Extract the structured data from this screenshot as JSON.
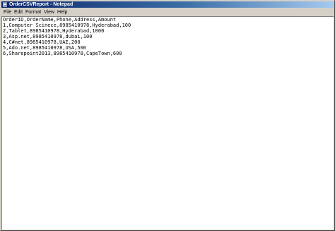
{
  "window": {
    "title": "OrderCSVReport - Notepad",
    "icon": "notepad-icon"
  },
  "menu": {
    "items": [
      {
        "label": "File"
      },
      {
        "label": "Edit"
      },
      {
        "label": "Format"
      },
      {
        "label": "View"
      },
      {
        "label": "Help"
      }
    ]
  },
  "editor": {
    "lines": [
      "OrderID,OrderName,Phone,Address,Amount",
      "1,Computer Scinece,8985410978,Hyderabad,100",
      "2,Tablet,8985410978,Hyderabad,1000",
      "3,Asp.net,8985410978,dubai,100",
      "4,C#net,8985410978,UAE,200",
      "5,Ado.net,8985410978,USA,500",
      "6,Sharepoint2013,8985410978,CapeTown,600"
    ]
  },
  "colors": {
    "titlebar_start": "#0a246a",
    "titlebar_end": "#a6caf0",
    "chrome": "#d4d0c8",
    "editor_background": "#ffffff",
    "text": "#000000"
  }
}
